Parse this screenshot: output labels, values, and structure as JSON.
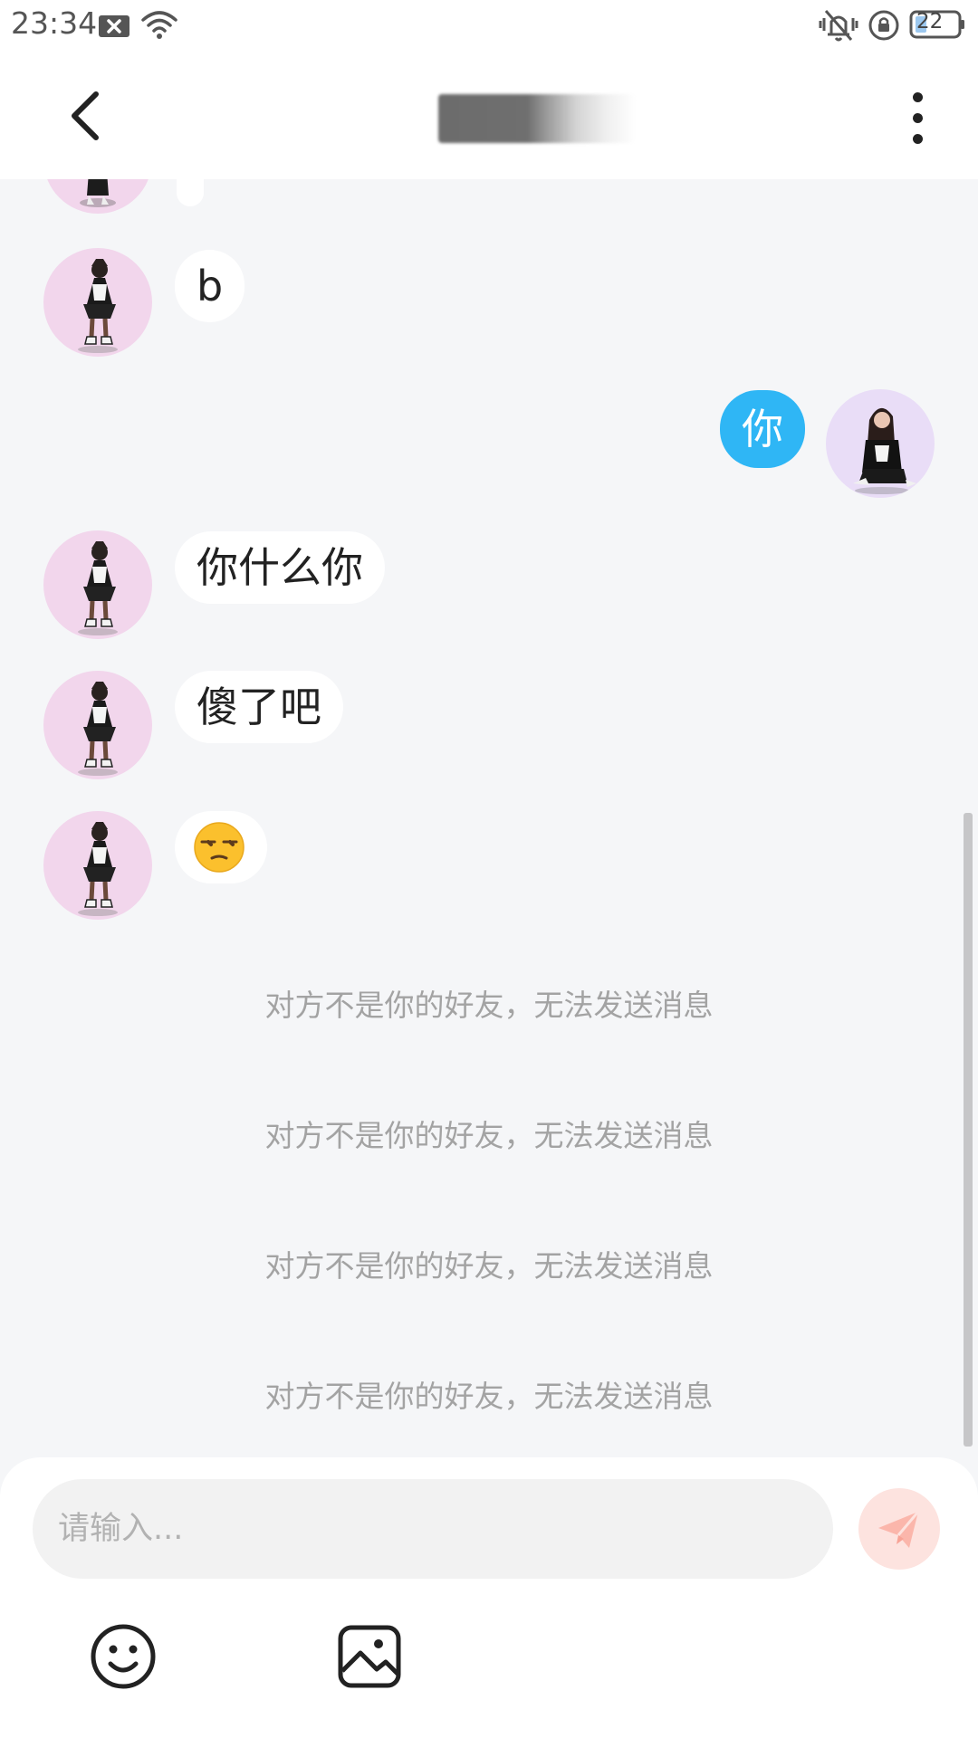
{
  "status_bar": {
    "time": "23:34",
    "battery_level": "22",
    "icons": [
      "notification-x-icon",
      "wifi-icon",
      "vibrate-icon",
      "rotation-lock-icon",
      "battery-icon"
    ]
  },
  "header": {
    "title": "年",
    "back_icon": "chevron-left-icon",
    "more_icon": "more-vertical-icon"
  },
  "messages": [
    {
      "side": "left",
      "text": "b"
    },
    {
      "side": "right",
      "text": "你"
    },
    {
      "side": "left",
      "text": "你什么你"
    },
    {
      "side": "left",
      "text": "傻了吧"
    },
    {
      "side": "left",
      "text": "😒"
    }
  ],
  "system_notices": [
    "对方不是你的好友，无法发送消息",
    "对方不是你的好友，无法发送消息",
    "对方不是你的好友，无法发送消息",
    "对方不是你的好友，无法发送消息"
  ],
  "composer": {
    "placeholder": "请输入...",
    "value": "",
    "send_icon": "paper-plane-icon",
    "emoji_icon": "smiley-icon",
    "image_icon": "image-icon"
  },
  "colors": {
    "chat_background": "#f5f6f8",
    "outgoing_bubble": "#2fb6f5",
    "incoming_bubble": "#ffffff",
    "system_text": "#a3a3a3",
    "send_button": "#fde3df"
  }
}
